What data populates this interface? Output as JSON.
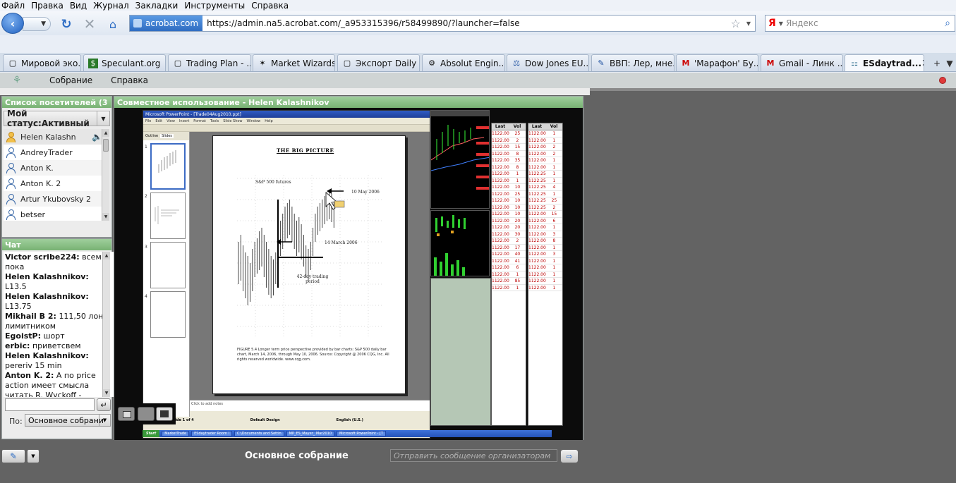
{
  "browser": {
    "menu": [
      "Файл",
      "Правка",
      "Вид",
      "Журнал",
      "Закладки",
      "Инструменты",
      "Справка"
    ],
    "site_identity": "acrobat.com",
    "url": "https://admin.na5.acrobat.com/_a953315396/r58499890/?launcher=false",
    "search_placeholder": "Яндекс",
    "search_engine_logo": "Я",
    "tabs": [
      {
        "label": "Мировой эко...",
        "icon": "page-icon"
      },
      {
        "label": "Speculant.org",
        "icon": "dollar-icon"
      },
      {
        "label": "Trading Plan - ...",
        "icon": "page-icon"
      },
      {
        "label": "Market Wizards",
        "icon": "star-icon"
      },
      {
        "label": "Экспорт Daily ...",
        "icon": "page-icon"
      },
      {
        "label": "Absolut Engin...",
        "icon": "gear-icon"
      },
      {
        "label": "Dow Jones EU...",
        "icon": "dowjones-icon"
      },
      {
        "label": "ВВП: Лер, мне...",
        "icon": "tag-icon"
      },
      {
        "label": "'Марафон' Бу...",
        "icon": "gmail-icon"
      },
      {
        "label": "Gmail - Линк ...",
        "icon": "gmail-icon"
      },
      {
        "label": "ESdaytrad...",
        "icon": "connect-icon",
        "active": true
      }
    ]
  },
  "app": {
    "menu": [
      "Собрание",
      "Справка"
    ],
    "attendees": {
      "title": "Список посетителей (3",
      "status": "Мой статус:Активный",
      "people": [
        {
          "name": "Helen Kalashn",
          "host": true
        },
        {
          "name": "AndreyTrader",
          "host": false
        },
        {
          "name": "Anton K.",
          "host": false
        },
        {
          "name": "Anton K. 2",
          "host": false
        },
        {
          "name": "Artur Ykubovsky 2",
          "host": false
        },
        {
          "name": "betser",
          "host": false
        }
      ]
    },
    "chat": {
      "title": "Чат",
      "messages": [
        {
          "from": "Victor scribe224:",
          "text": "всем пока"
        },
        {
          "from": "Helen Kalashnikov:",
          "text": "L13.5"
        },
        {
          "from": "Helen Kalashnikov:",
          "text": "L13.75"
        },
        {
          "from": "Mikhail B 2:",
          "text": "111,50 лонг лимитником"
        },
        {
          "from": "EgoistP:",
          "text": "шорт"
        },
        {
          "from": "erbic:",
          "text": "приветсвем"
        },
        {
          "from": "Helen Kalashnikov:",
          "text": "pereriv 15 min"
        },
        {
          "from": "Anton K. 2:",
          "text": "А по price action имеет смысла читать R. Wyckoff -"
        }
      ],
      "to_label": "По:",
      "to_value": "Основное собрани"
    },
    "share": {
      "title": "Совместное использование - Helen Kalashnikov",
      "ppt_title": "Microsoft PowerPoint - [Trade04Aug2010.ppt]",
      "ppt_menu": [
        "File",
        "Edit",
        "View",
        "Insert",
        "Format",
        "Tools",
        "Slide Show",
        "Window",
        "Help"
      ],
      "ppt_tabs": [
        "Outline",
        "Slides"
      ],
      "slide_heading": "THE BIG PICTURE",
      "slide_label_sp": "S&P 500 futures",
      "slide_label_may": "10 May 2006",
      "slide_label_march": "14 March 2006",
      "slide_label_period": "42-day trading period",
      "slide_caption": "FIGURE 5.4  Longer term price perspective provided by bar charts: S&P 500 daily bar chart, March 14, 2006, through May 10, 2006. Source: Copyright @ 2006 CQG, Inc. All rights reserved worldwide. www.cqg.com.",
      "notes": "Click to add notes",
      "status_slide": "Slide 1 of 4",
      "status_design": "Default Design",
      "status_lang": "English (U.S.)",
      "taskbar_start": "Start",
      "taskbar_tasks": [
        "MarketTrade",
        "ESdaytrader Room I",
        "C:\\Documents and Settin",
        "MP_ES_Mayer_ Mar2010",
        "Microsoft PowerPoint - [T"
      ],
      "ladder_headers": [
        "Last",
        "Vol",
        "Last",
        "Vol"
      ],
      "ladder_price": "1122.00",
      "ladder_price_alt": "1122.25"
    },
    "bottom": {
      "room_name": "Основное собрание",
      "host_msg_placeholder": "Отправить сообщение организаторам"
    }
  }
}
